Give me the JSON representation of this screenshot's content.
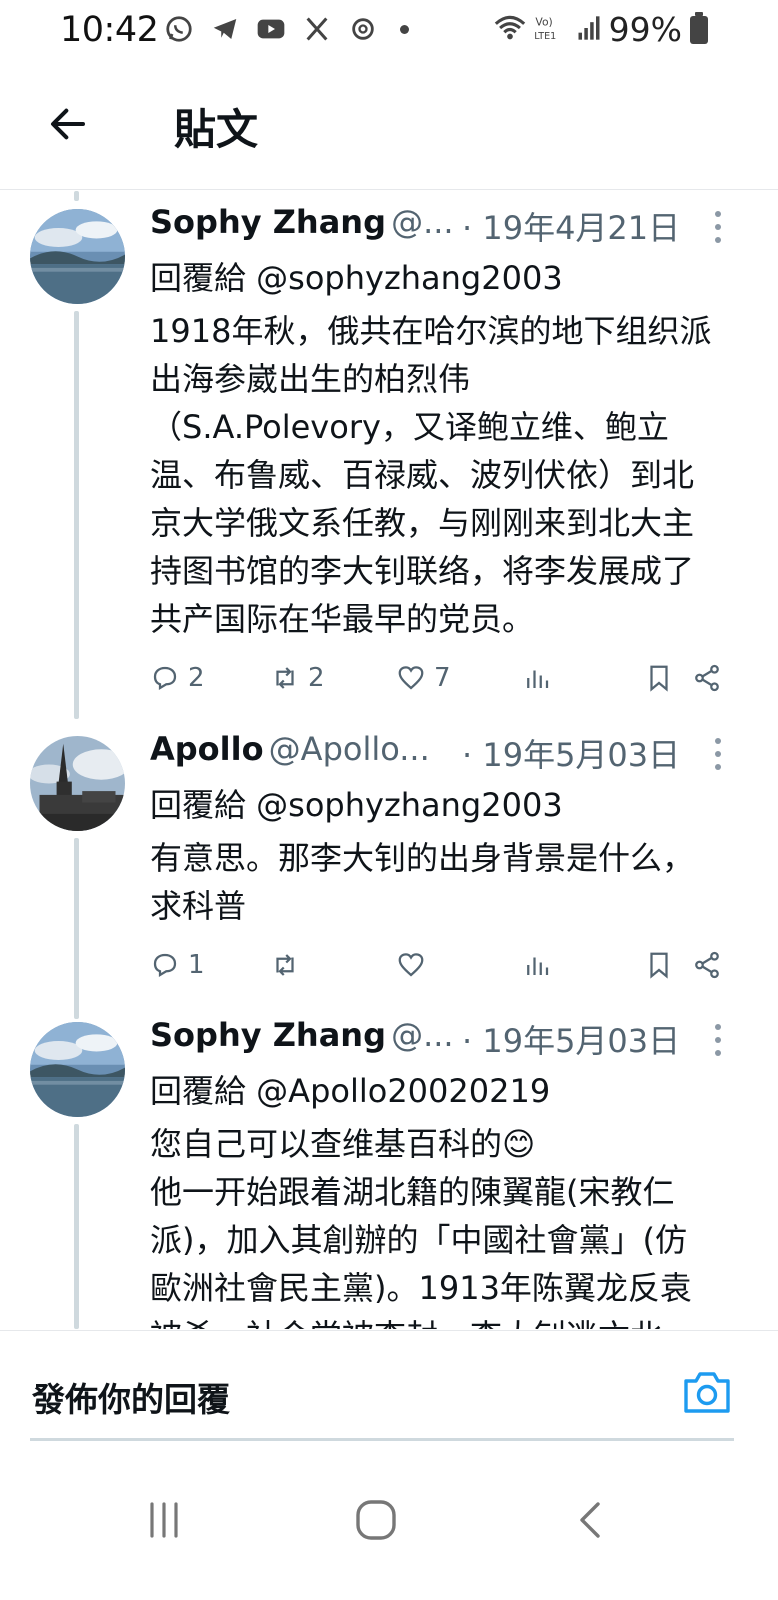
{
  "status_bar": {
    "time": "10:42",
    "battery_text": "99%",
    "icons": [
      "whatsapp-icon",
      "telegram-icon",
      "youtube-icon",
      "x-icon",
      "threads-icon",
      "dot-icon",
      "wifi-icon",
      "volte-icon",
      "signal-icon",
      "battery-icon"
    ]
  },
  "header": {
    "title": "貼文",
    "back_icon": "arrow-left-icon"
  },
  "tweets": [
    {
      "name": "Sophy Zhang",
      "handle": "@...",
      "date": "· 19年4月21日",
      "reply_to": "回覆給 @sophyzhang2003",
      "body_lines": [
        "1918年秋，俄共在哈尔滨的地下组织派",
        "出海参崴出生的柏烈伟",
        "（S.A.Polevory，又译鲍立维、鲍立",
        "温、布鲁威、百禄威、波列伏依）到北",
        "京大学俄文系任教，与刚刚来到北大主",
        "持图书馆的李大钊联络，将李发展成了",
        "共产国际在华最早的党员。"
      ],
      "replies": "2",
      "retweets": "2",
      "likes": "7"
    },
    {
      "name": "Apollo",
      "handle": "@Apollo...",
      "date": "· 19年5月03日",
      "reply_to": "回覆給 @sophyzhang2003",
      "body_lines": [
        "有意思。那李大钊的出身背景是什么，",
        "求科普"
      ],
      "replies": "1",
      "retweets": "",
      "likes": ""
    },
    {
      "name": "Sophy Zhang",
      "handle": "@...",
      "date": "· 19年5月03日",
      "reply_to": "回覆給 @Apollo20020219",
      "body_lines": [
        "您自己可以查维基百科的😊",
        "他一开始跟着湖北籍的陳翼龍(宋教仁",
        "派)，加入其創辦的「中國社會黨」(仿",
        "歐洲社會民主黨)。1913年陈翼龙反袁",
        "被杀，社会党被查封，李大钊逃亡北"
      ]
    }
  ],
  "composer": {
    "placeholder": "發佈你的回覆",
    "camera_icon": "camera-icon"
  },
  "nav": {
    "icons": [
      "recents-icon",
      "home-icon",
      "back-icon"
    ]
  },
  "colors": {
    "text": "#0f1419",
    "secondary": "#536471",
    "thread_line": "#cfd9de",
    "accent": "#1d9bf0"
  }
}
